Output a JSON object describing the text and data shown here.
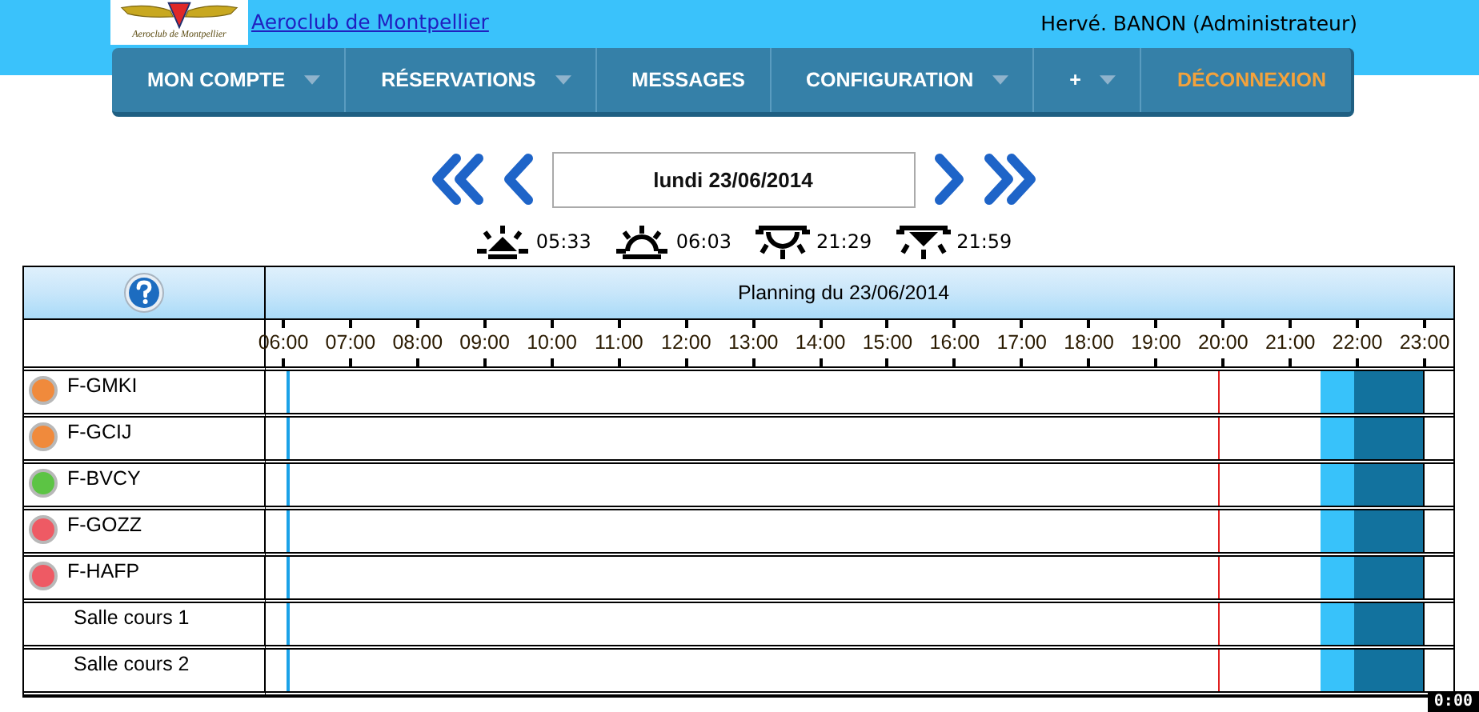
{
  "header": {
    "logo_text": "Aeroclub de Montpellier",
    "site_link": "Aeroclub de Montpellier",
    "user": "Hervé. BANON (Administrateur)"
  },
  "nav": [
    {
      "label": "MON COMPTE",
      "kind": "menu",
      "has_menu": true
    },
    {
      "label": "RÉSERVATIONS",
      "kind": "menu",
      "has_menu": true
    },
    {
      "label": "MESSAGES",
      "kind": "menu",
      "has_menu": false
    },
    {
      "label": "CONFIGURATION",
      "kind": "menu",
      "has_menu": true
    },
    {
      "label": "+",
      "kind": "menu",
      "has_menu": true
    },
    {
      "label": "DÉCONNEXION",
      "kind": "logout",
      "has_menu": false
    }
  ],
  "date_nav": {
    "date": "lundi 23/06/2014"
  },
  "sun_times": [
    {
      "kind": "dawn",
      "time": "05:33"
    },
    {
      "kind": "sunrise",
      "time": "06:03"
    },
    {
      "kind": "sunset",
      "time": "21:29"
    },
    {
      "kind": "dusk",
      "time": "21:59"
    }
  ],
  "planning": {
    "title": "Planning du 23/06/2014",
    "hours": [
      "06:00",
      "07:00",
      "08:00",
      "09:00",
      "10:00",
      "11:00",
      "12:00",
      "13:00",
      "14:00",
      "15:00",
      "16:00",
      "17:00",
      "18:00",
      "19:00",
      "20:00",
      "21:00",
      "22:00",
      "23:00"
    ],
    "current_time_marker": {
      "level": 0.82
    },
    "rows": [
      {
        "name": "F-GMKI",
        "kind": "aircraft",
        "color": "#f08a3c"
      },
      {
        "name": "F-GCIJ",
        "kind": "aircraft",
        "color": "#f08a3c"
      },
      {
        "name": "F-BVCY",
        "kind": "aircraft",
        "color": "#5cc444"
      },
      {
        "name": "F-GOZZ",
        "kind": "aircraft",
        "color": "#ee5a64"
      },
      {
        "name": "F-HAFP",
        "kind": "aircraft",
        "color": "#ee5a64"
      },
      {
        "name": "Salle cours 1",
        "kind": "room"
      },
      {
        "name": "Salle cours 2",
        "kind": "room"
      }
    ]
  },
  "time_badge": "0:00"
}
